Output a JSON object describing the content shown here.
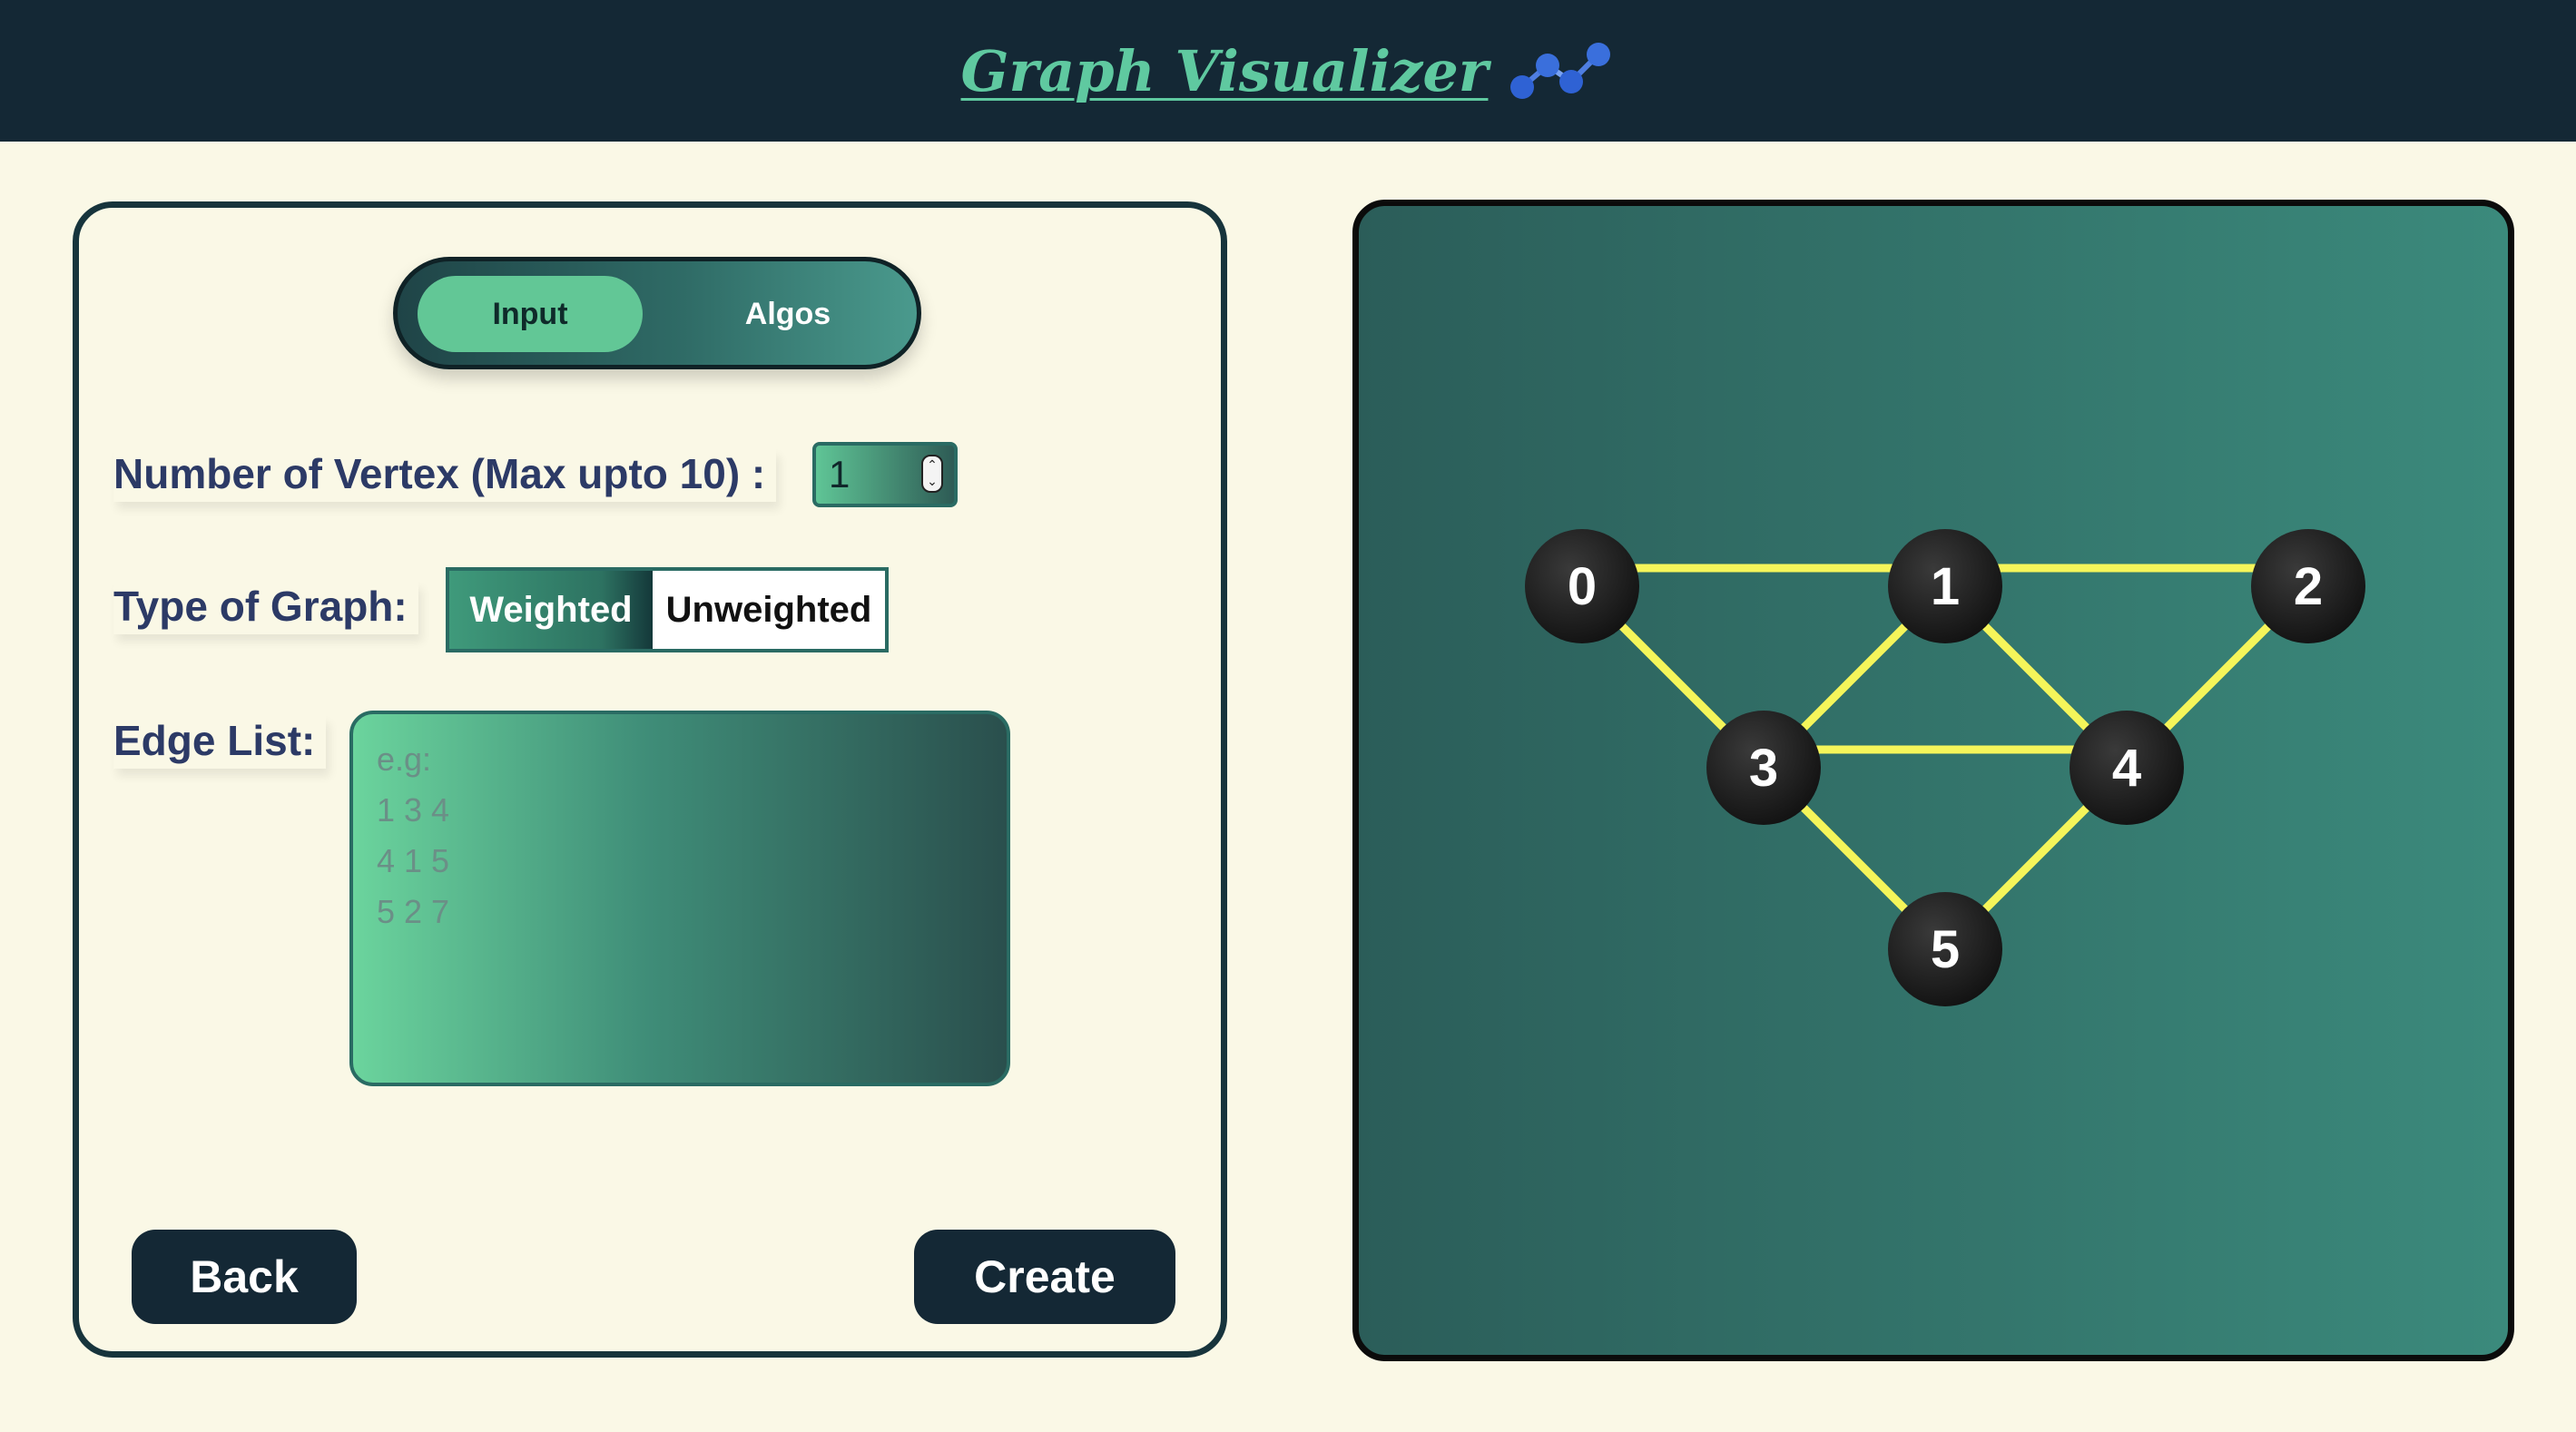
{
  "header": {
    "title": "Graph Visualizer",
    "icon": "graph-nodes-icon"
  },
  "colors": {
    "header_bg": "#142835",
    "page_bg": "#faf8e6",
    "accent": "#5fc9a0",
    "edge": "#f5f55a",
    "node": "#1c1c1c"
  },
  "tabs": {
    "input_label": "Input",
    "algos_label": "Algos",
    "active": "Input"
  },
  "form": {
    "vertex_label": "Number of Vertex (Max upto 10) :",
    "vertex_value": "1",
    "type_label": "Type of Graph:",
    "weighted_label": "Weighted",
    "unweighted_label": "Unweighted",
    "selected_type": "Weighted",
    "edge_label": "Edge List:",
    "edge_placeholder": "e.g:\n1 3 4\n4 1 5\n5 2 7"
  },
  "buttons": {
    "back": "Back",
    "create": "Create"
  },
  "graph": {
    "nodes": [
      "0",
      "1",
      "2",
      "3",
      "4",
      "5"
    ],
    "edges": [
      [
        "0",
        "1"
      ],
      [
        "1",
        "2"
      ],
      [
        "0",
        "3"
      ],
      [
        "1",
        "3"
      ],
      [
        "1",
        "4"
      ],
      [
        "2",
        "4"
      ],
      [
        "3",
        "4"
      ],
      [
        "3",
        "5"
      ],
      [
        "4",
        "5"
      ]
    ]
  }
}
